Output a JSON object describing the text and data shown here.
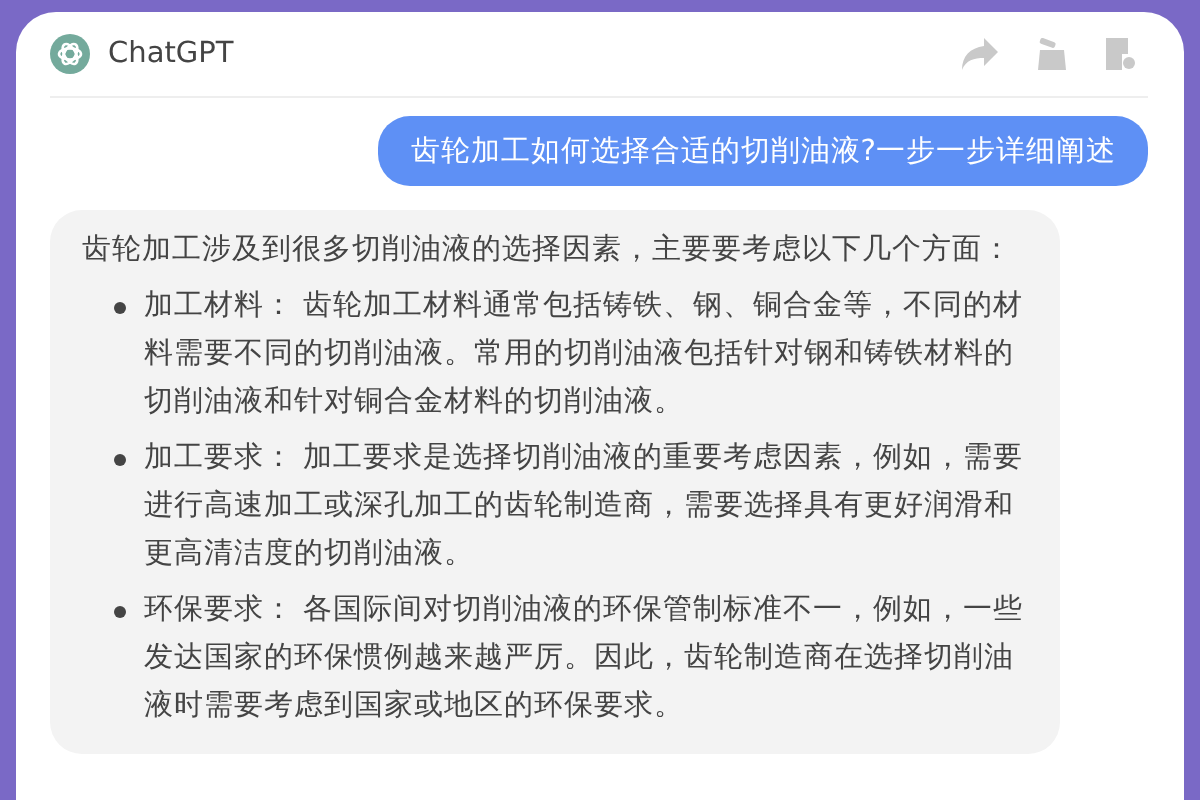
{
  "header": {
    "title": "ChatGPT",
    "actions": [
      {
        "kind": "share"
      },
      {
        "kind": "clean"
      },
      {
        "kind": "note"
      }
    ]
  },
  "messages": [
    {
      "kind": "user",
      "text": "齿轮加工如何选择合适的切削油液?一步一步详细阐述"
    },
    {
      "kind": "assistant",
      "intro": "齿轮加工涉及到很多切削油液的选择因素，主要要考虑以下几个方面：",
      "items": [
        "加工材料： 齿轮加工材料通常包括铸铁、钢、铜合金等，不同的材料需要不同的切削油液。常用的切削油液包括针对钢和铸铁材料的切削油液和针对铜合金材料的切削油液。",
        "加工要求： 加工要求是选择切削油液的重要考虑因素，例如，需要进行高速加工或深孔加工的齿轮制造商，需要选择具有更好润滑和更高清洁度的切削油液。",
        "环保要求： 各国际间对切削油液的环保管制标准不一，例如，一些发达国家的环保惯例越来越严厉。因此，齿轮制造商在选择切削油液时需要考虑到国家或地区的环保要求。"
      ]
    }
  ]
}
